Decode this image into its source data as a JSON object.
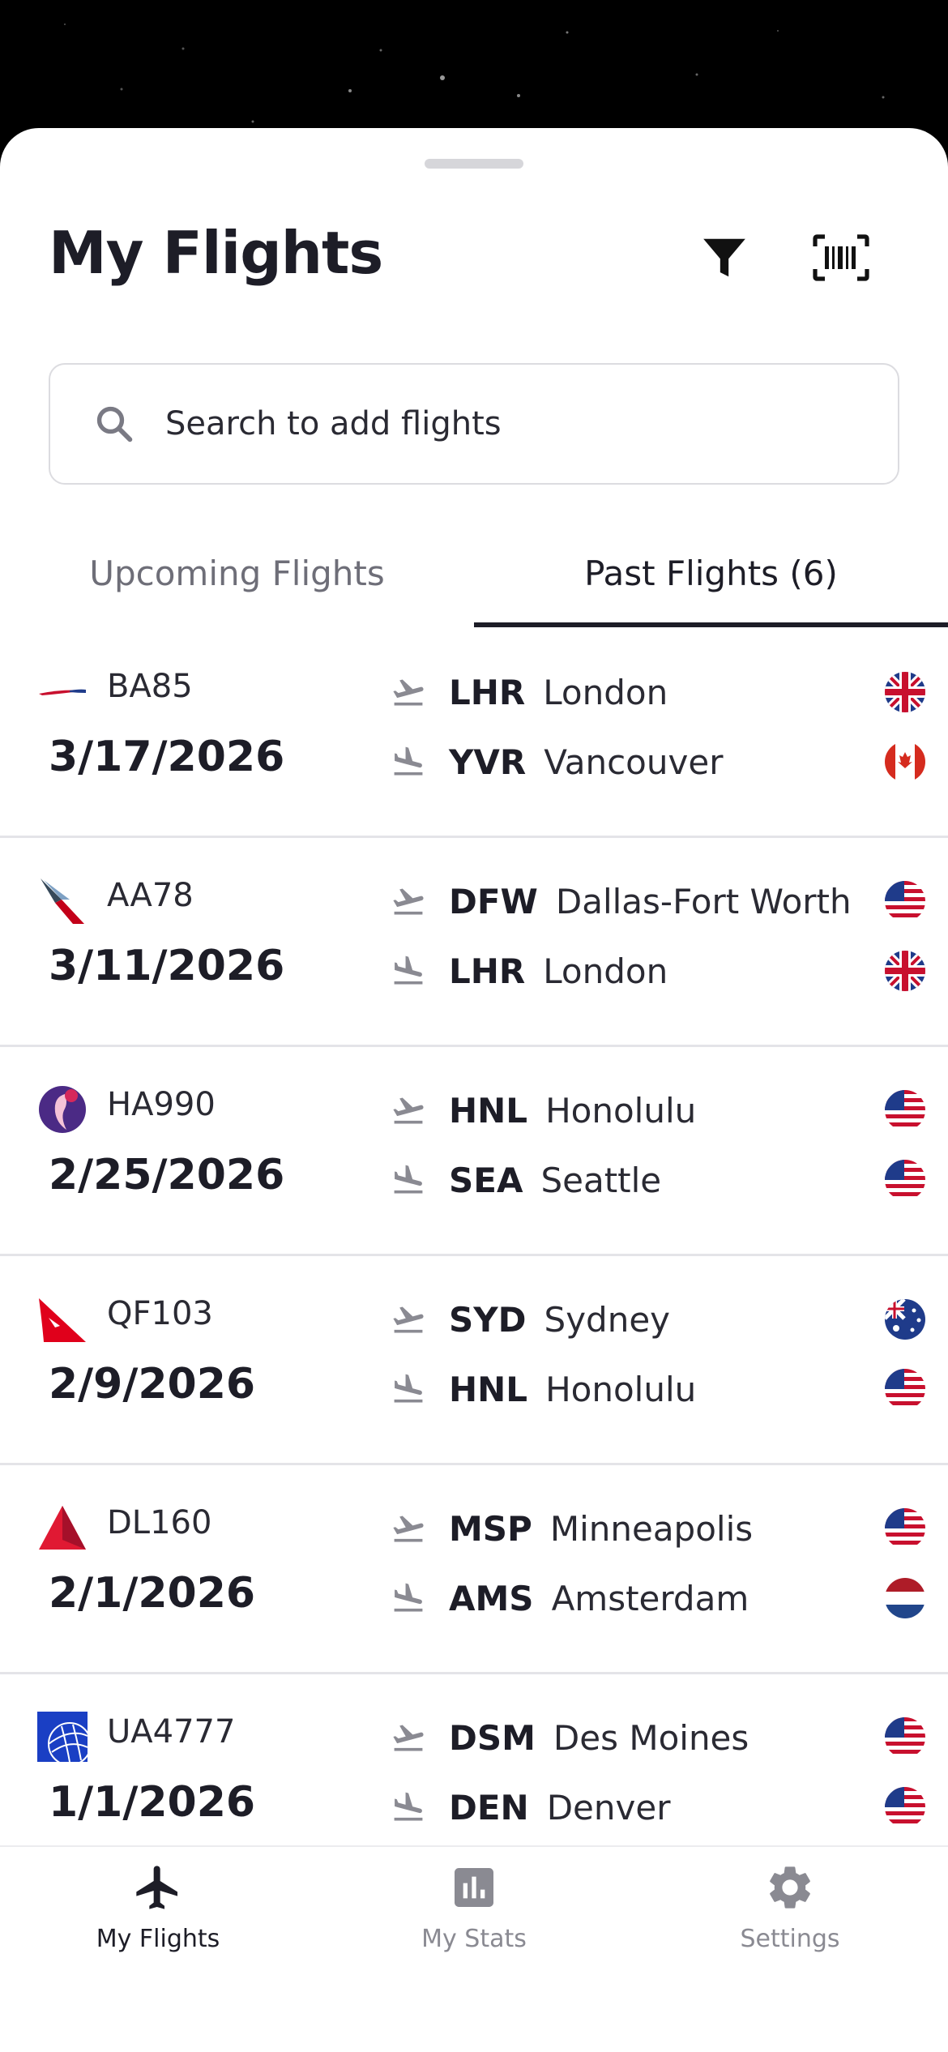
{
  "header": {
    "title": "My Flights",
    "filter_icon": "filter-icon",
    "scan_icon": "barcode-scan-icon"
  },
  "search": {
    "placeholder": "Search to add flights",
    "icon": "search-icon"
  },
  "tabs": [
    {
      "label": "Upcoming Flights",
      "active": false
    },
    {
      "label": "Past Flights (6)",
      "active": true
    }
  ],
  "flights": [
    {
      "airline_logo": "british-airways-logo",
      "flight": "BA85",
      "date": "3/17/2026",
      "dep": {
        "code": "LHR",
        "city": "London",
        "flag": "uk"
      },
      "arr": {
        "code": "YVR",
        "city": "Vancouver",
        "flag": "ca"
      }
    },
    {
      "airline_logo": "american-airlines-logo",
      "flight": "AA78",
      "date": "3/11/2026",
      "dep": {
        "code": "DFW",
        "city": "Dallas-Fort Worth",
        "flag": "us"
      },
      "arr": {
        "code": "LHR",
        "city": "London",
        "flag": "uk"
      }
    },
    {
      "airline_logo": "hawaiian-airlines-logo",
      "flight": "HA990",
      "date": "2/25/2026",
      "dep": {
        "code": "HNL",
        "city": "Honolulu",
        "flag": "us"
      },
      "arr": {
        "code": "SEA",
        "city": "Seattle",
        "flag": "us"
      }
    },
    {
      "airline_logo": "qantas-logo",
      "flight": "QF103",
      "date": "2/9/2026",
      "dep": {
        "code": "SYD",
        "city": "Sydney",
        "flag": "au"
      },
      "arr": {
        "code": "HNL",
        "city": "Honolulu",
        "flag": "us"
      }
    },
    {
      "airline_logo": "delta-logo",
      "flight": "DL160",
      "date": "2/1/2026",
      "dep": {
        "code": "MSP",
        "city": "Minneapolis",
        "flag": "us"
      },
      "arr": {
        "code": "AMS",
        "city": "Amsterdam",
        "flag": "nl"
      }
    },
    {
      "airline_logo": "united-logo",
      "flight": "UA4777",
      "date": "1/1/2026",
      "dep": {
        "code": "DSM",
        "city": "Des Moines",
        "flag": "us"
      },
      "arr": {
        "code": "DEN",
        "city": "Denver",
        "flag": "us"
      }
    }
  ],
  "tabbar": [
    {
      "label": "My Flights",
      "icon": "airplane-icon",
      "active": true
    },
    {
      "label": "My Stats",
      "icon": "stats-chart-icon",
      "active": false
    },
    {
      "label": "Settings",
      "icon": "gear-icon",
      "active": false
    }
  ],
  "colors": {
    "text": "#1d1d27",
    "muted": "#6e6e78",
    "divider": "#e4e4e8",
    "tab_inactive": "#8a8a92"
  }
}
